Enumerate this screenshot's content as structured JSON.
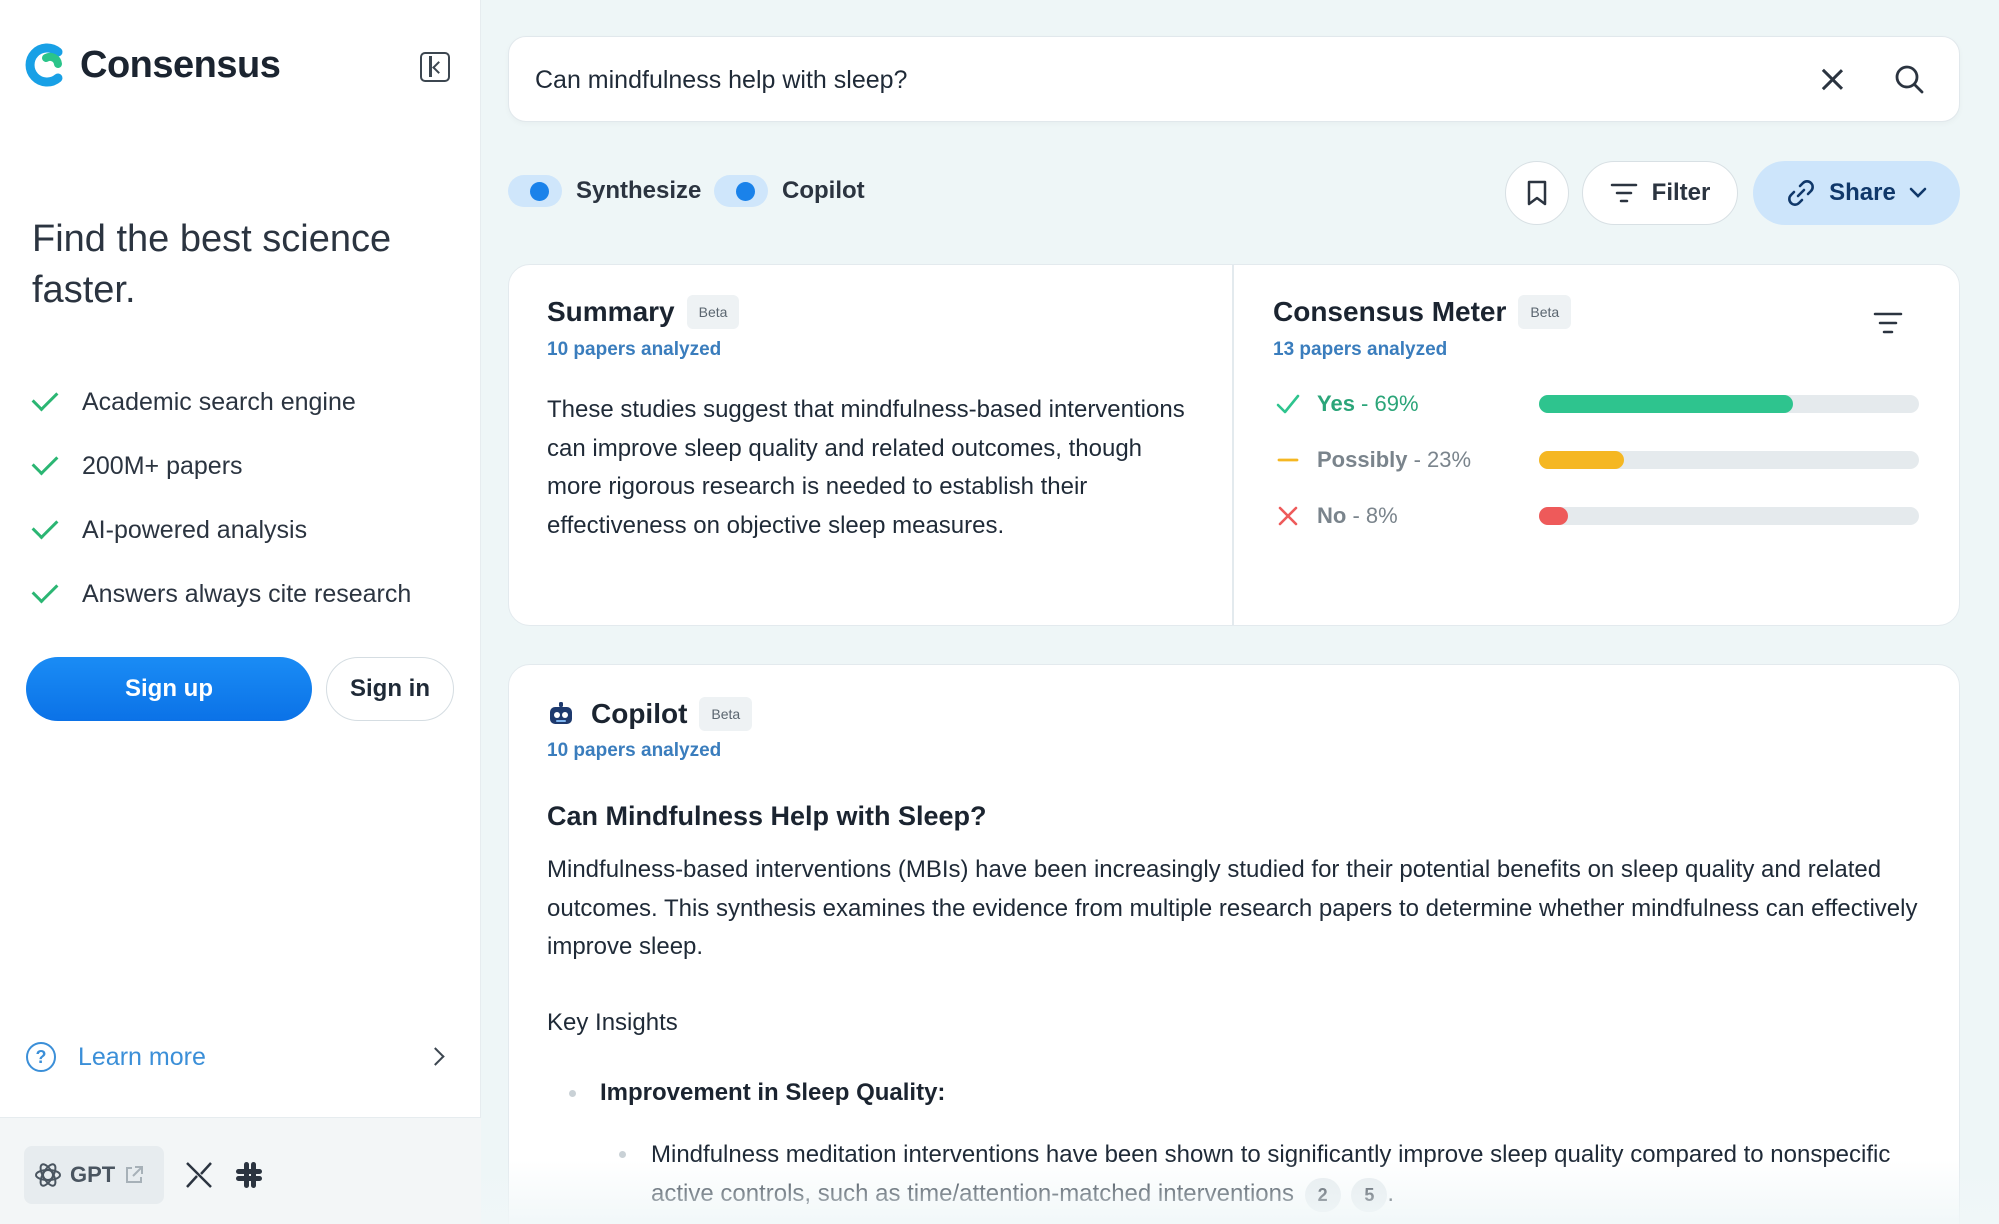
{
  "sidebar": {
    "brand": "Consensus",
    "tagline": "Find the best science faster.",
    "features": [
      "Academic search engine",
      "200M+ papers",
      "AI-powered analysis",
      "Answers always cite research"
    ],
    "signup_label": "Sign up",
    "signin_label": "Sign in",
    "learn_more_label": "Learn more",
    "footer": {
      "gpt_label": "GPT"
    }
  },
  "search": {
    "query": "Can mindfulness help with sleep?"
  },
  "toolbar": {
    "toggles": [
      {
        "label": "Synthesize",
        "on": true
      },
      {
        "label": "Copilot",
        "on": true
      }
    ],
    "filter_label": "Filter",
    "share_label": "Share"
  },
  "summary": {
    "title": "Summary",
    "beta": "Beta",
    "count": "10 papers analyzed",
    "body": "These studies suggest that mindfulness-based interventions can improve sleep quality and related outcomes, though more rigorous research is needed to establish their effectiveness on objective sleep measures."
  },
  "meter": {
    "title": "Consensus Meter",
    "beta": "Beta",
    "count": "13 papers analyzed",
    "rows": [
      {
        "label": "Yes",
        "pct_text": "69%",
        "value": 0.69,
        "color": "#2ec48e",
        "text_color": "#2ba579",
        "icon": "check-icon"
      },
      {
        "label": "Possibly",
        "pct_text": "23%",
        "value": 0.23,
        "color": "#f5b722",
        "text_color": "#7a848c",
        "icon": "dash-icon"
      },
      {
        "label": "No",
        "pct_text": "8%",
        "value": 0.08,
        "color": "#ee5a5a",
        "text_color": "#7a848c",
        "icon": "cross-icon"
      }
    ]
  },
  "copilot": {
    "title": "Copilot",
    "beta": "Beta",
    "count": "10 papers analyzed",
    "heading": "Can Mindfulness Help with Sleep?",
    "intro": "Mindfulness-based interventions (MBIs) have been increasingly studied for their potential benefits on sleep quality and related outcomes. This synthesis examines the evidence from multiple research papers to determine whether mindfulness can effectively improve sleep.",
    "key_insights": "Key Insights",
    "bullet_title": "Improvement in Sleep Quality:",
    "sub_bullet": "Mindfulness meditation interventions have been shown to significantly improve sleep quality compared to nonspecific active controls, such as time/attention-matched interventions",
    "citations": [
      "2",
      "5"
    ],
    "trailing": "."
  },
  "colors": {
    "accent": "#1a82ea",
    "link": "#3a7dbd",
    "success": "#2bb673"
  }
}
